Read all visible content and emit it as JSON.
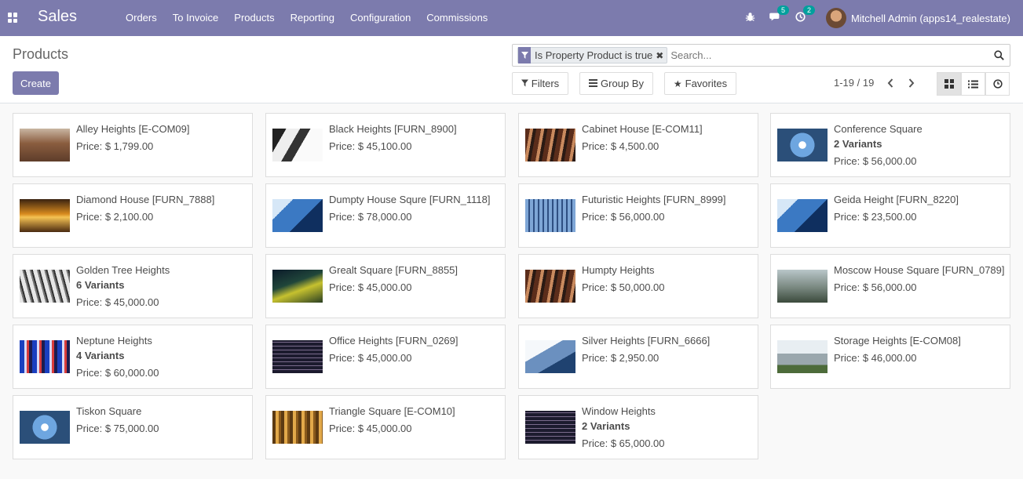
{
  "navbar": {
    "app_name": "Sales",
    "menu": [
      "Orders",
      "To Invoice",
      "Products",
      "Reporting",
      "Configuration",
      "Commissions"
    ],
    "messages_badge": "5",
    "activities_badge": "2",
    "user_name": "Mitchell Admin (apps14_realestate)"
  },
  "control": {
    "title": "Products",
    "create_label": "Create",
    "facet_label": "Is Property Product is true",
    "search_placeholder": "Search...",
    "filters_label": "Filters",
    "groupby_label": "Group By",
    "favorites_label": "Favorites",
    "pager": "1-19 / 19"
  },
  "colors": {
    "brand": "#7c7bad",
    "badge": "#00a09d"
  },
  "products": [
    {
      "name": "Alley Heights [E-COM09]",
      "variants": "",
      "price": "Price: $ 1,799.00",
      "img": "alley"
    },
    {
      "name": "Black Heights [FURN_8900]",
      "variants": "",
      "price": "Price: $ 45,100.00",
      "img": "black"
    },
    {
      "name": "Cabinet House [E-COM11]",
      "variants": "",
      "price": "Price: $ 4,500.00",
      "img": "escalator"
    },
    {
      "name": "Conference Square",
      "variants": "2 Variants",
      "price": "Price: $ 56,000.00",
      "img": "sky"
    },
    {
      "name": "Diamond House [FURN_7888]",
      "variants": "",
      "price": "Price: $ 2,100.00",
      "img": "louvre"
    },
    {
      "name": "Dumpty House Squre [FURN_1118]",
      "variants": "",
      "price": "Price: $ 78,000.00",
      "img": "glass"
    },
    {
      "name": "Futuristic Heights [FURN_8999]",
      "variants": "",
      "price": "Price: $ 56,000.00",
      "img": "tower"
    },
    {
      "name": "Geida Height [FURN_8220]",
      "variants": "",
      "price": "Price: $ 23,500.00",
      "img": "glass"
    },
    {
      "name": "Golden Tree Heights",
      "variants": "6 Variants",
      "price": "Price: $ 45,000.00",
      "img": "mono"
    },
    {
      "name": "Grealt Square [FURN_8855]",
      "variants": "",
      "price": "Price: $ 45,000.00",
      "img": "night"
    },
    {
      "name": "Humpty Heights",
      "variants": "",
      "price": "Price: $ 50,000.00",
      "img": "escalator"
    },
    {
      "name": "Moscow House Square [FURN_0789]",
      "variants": "",
      "price": "Price: $ 56,000.00",
      "img": "city"
    },
    {
      "name": "Neptune Heights",
      "variants": "4 Variants",
      "price": "Price: $ 60,000.00",
      "img": "colorful"
    },
    {
      "name": "Office Heights [FURN_0269]",
      "variants": "",
      "price": "Price: $ 45,000.00",
      "img": "windows"
    },
    {
      "name": "Silver Heights [FURN_6666]",
      "variants": "",
      "price": "Price: $ 2,950.00",
      "img": "silver"
    },
    {
      "name": "Storage Heights [E-COM08]",
      "variants": "",
      "price": "Price: $ 46,000.00",
      "img": "storage"
    },
    {
      "name": "Tiskon Square",
      "variants": "",
      "price": "Price: $ 75,000.00",
      "img": "sky"
    },
    {
      "name": "Triangle Square [E-COM10]",
      "variants": "",
      "price": "Price: $ 45,000.00",
      "img": "gold"
    },
    {
      "name": "Window Heights",
      "variants": "2 Variants",
      "price": "Price: $ 65,000.00",
      "img": "windows"
    }
  ]
}
